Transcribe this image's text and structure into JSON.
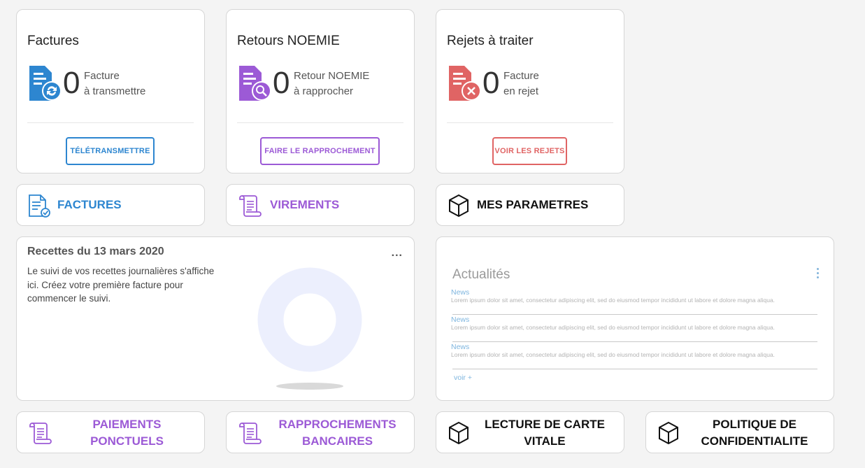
{
  "summary": [
    {
      "title": "Factures",
      "count": "0",
      "label_line1": "Facture",
      "label_line2": "à transmettre",
      "button": "TÉLÉTRANSMETTRE",
      "color": "#2d86d0",
      "icon": "invoice-sync-icon"
    },
    {
      "title": "Retours NOEMIE",
      "count": "0",
      "label_line1": "Retour NOEMIE",
      "label_line2": "à rapprocher",
      "button": "FAIRE LE RAPPROCHEMENT",
      "color": "#9c5ad6",
      "icon": "invoice-search-icon"
    },
    {
      "title": "Rejets à traiter",
      "count": "0",
      "label_line1": "Facture",
      "label_line2": "en rejet",
      "button": "VOIR LES REJETS",
      "color": "#e06464",
      "icon": "invoice-reject-icon"
    }
  ],
  "nav": {
    "factures": "FACTURES",
    "virements": "VIREMENTS",
    "parametres": "MES PARAMETRES",
    "paiements_l1": "PAIEMENTS",
    "paiements_l2": "PONCTUELS",
    "rapprochements_l1": "RAPPROCHEMENTS",
    "rapprochements_l2": "BANCAIRES",
    "lecture_l1": "LECTURE DE CARTE",
    "lecture_l2": "VITALE",
    "politique_l1": "POLITIQUE DE",
    "politique_l2": "CONFIDENTIALITE"
  },
  "colors": {
    "blue": "#2d86d0",
    "purple": "#9c5ad6",
    "red": "#e06464",
    "donut": "#eceffd"
  },
  "recettes": {
    "title": "Recettes du 13 mars 2020",
    "text": "Le suivi de vos recettes journalières s'affiche ici. Créez votre première facture pour commencer le suivi.",
    "menu": "..."
  },
  "news": {
    "title": "Actualités",
    "items": [
      {
        "label": "News",
        "text": "Lorem ipsum dolor sit amet, consectetur adipiscing elit, sed do eiusmod tempor incididunt ut labore et dolore magna aliqua."
      },
      {
        "label": "News",
        "text": "Lorem ipsum dolor sit amet, consectetur adipiscing elit, sed do eiusmod tempor incididunt ut labore et dolore magna aliqua."
      },
      {
        "label": "News",
        "text": "Lorem ipsum dolor sit amet, consectetur adipiscing elit, sed do eiusmod tempor incididunt ut labore et dolore magna aliqua."
      }
    ],
    "more": "voir +"
  }
}
